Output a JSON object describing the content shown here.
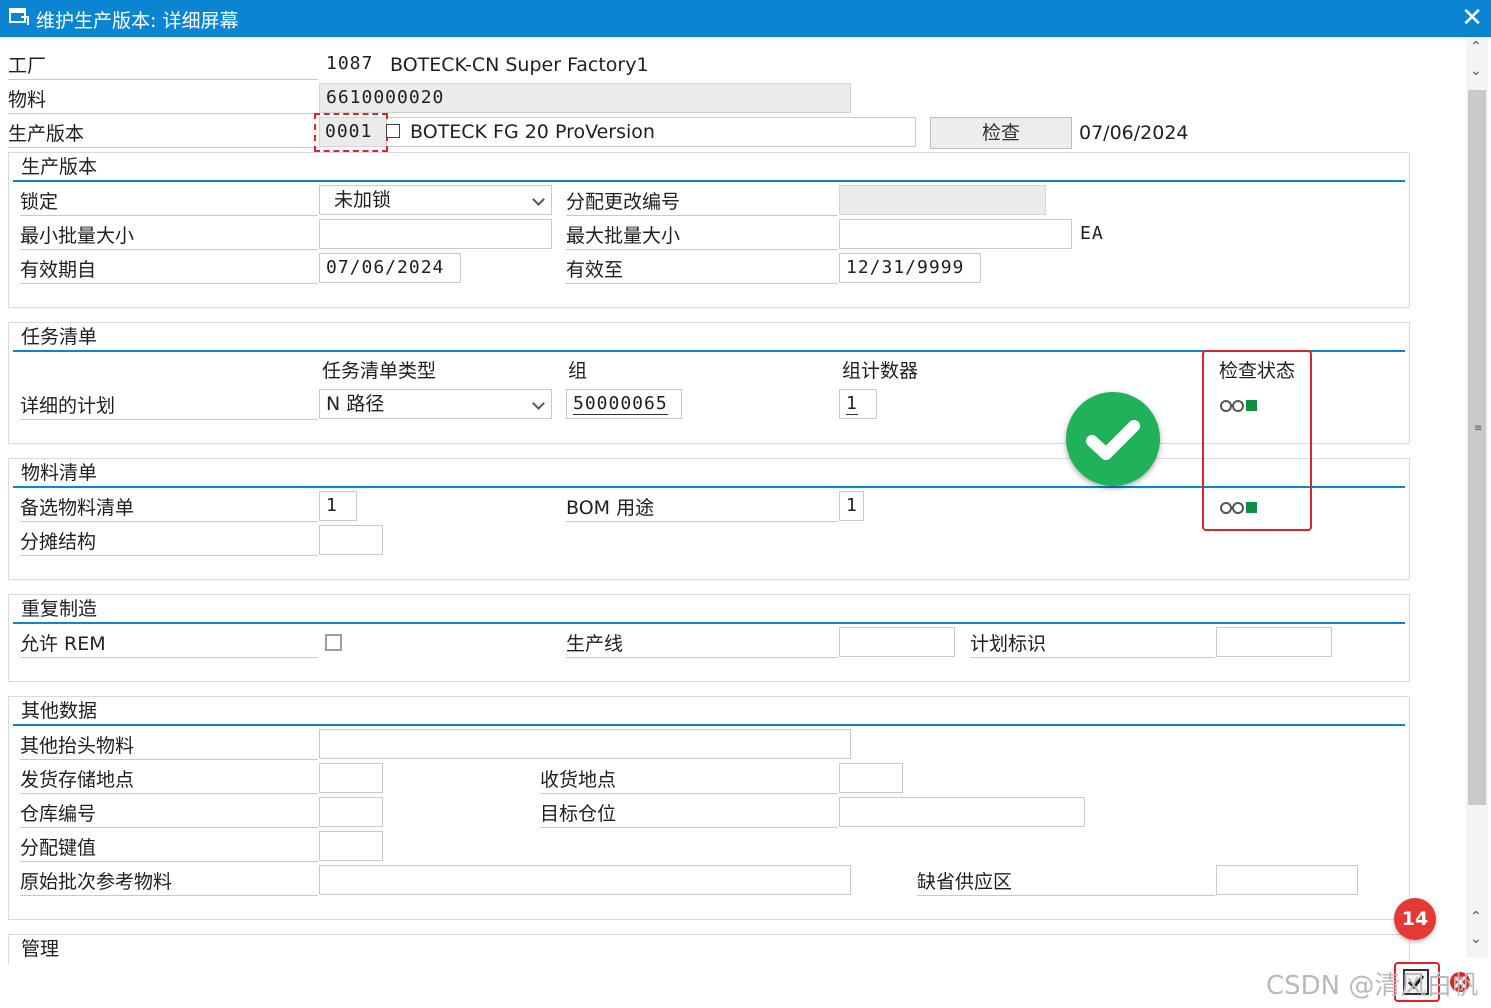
{
  "window": {
    "title": "维护生产版本: 详细屏幕",
    "close_icon": "close-icon"
  },
  "header": {
    "plant_label": "工厂",
    "plant_value": "1087",
    "plant_desc": "BOTECK-CN Super Factory1",
    "material_label": "物料",
    "material_value": "6610000020",
    "version_label": "生产版本",
    "version_value": "0001",
    "version_desc": "BOTECK FG 20 ProVersion",
    "check_button": "检查",
    "check_date": "07/06/2024"
  },
  "prod_version": {
    "title": "生产版本",
    "lock_label": "锁定",
    "lock_value": "未加锁",
    "change_no_label": "分配更改编号",
    "change_no_value": "",
    "min_lot_label": "最小批量大小",
    "min_lot_value": "",
    "max_lot_label": "最大批量大小",
    "max_lot_value": "",
    "unit": "EA",
    "valid_from_label": "有效期自",
    "valid_from_value": "07/06/2024",
    "valid_to_label": "有效至",
    "valid_to_value": "12/31/9999"
  },
  "task_list": {
    "title": "任务清单",
    "type_header": "任务清单类型",
    "group_header": "组",
    "counter_header": "组计数器",
    "status_header": "检查状态",
    "row_label": "详细的计划",
    "type_value": "N 路径",
    "group_value": "50000065",
    "counter_value": "1"
  },
  "bom": {
    "title": "物料清单",
    "alt_label": "备选物料清单",
    "alt_value": "1",
    "usage_label": "BOM 用途",
    "usage_value": "1",
    "apportion_label": "分摊结构",
    "apportion_value": ""
  },
  "rem": {
    "title": "重复制造",
    "allow_label": "允许 REM",
    "allow_checked": false,
    "line_label": "生产线",
    "line_value": "",
    "plan_id_label": "计划标识",
    "plan_id_value": ""
  },
  "other": {
    "title": "其他数据",
    "other_material_label": "其他抬头物料",
    "other_material_value": "",
    "issue_sloc_label": "发货存储地点",
    "issue_sloc_value": "",
    "receiving_label": "收货地点",
    "receiving_value": "",
    "wh_no_label": "仓库编号",
    "wh_no_value": "",
    "dest_bin_label": "目标仓位",
    "dest_bin_value": "",
    "alloc_key_label": "分配键值",
    "alloc_key_value": "",
    "orig_batch_label": "原始批次参考物料",
    "orig_batch_value": "",
    "default_supply_label": "缺省供应区",
    "default_supply_value": ""
  },
  "admin": {
    "title": "管理"
  },
  "annotation": {
    "badge": "14"
  },
  "watermark": "CSDN @清风白帆",
  "colors": {
    "title_bar": "#0a86d0",
    "status_ok": "#0e8f3f",
    "highlight": "#e0222a",
    "confirm": "#21b15a"
  }
}
